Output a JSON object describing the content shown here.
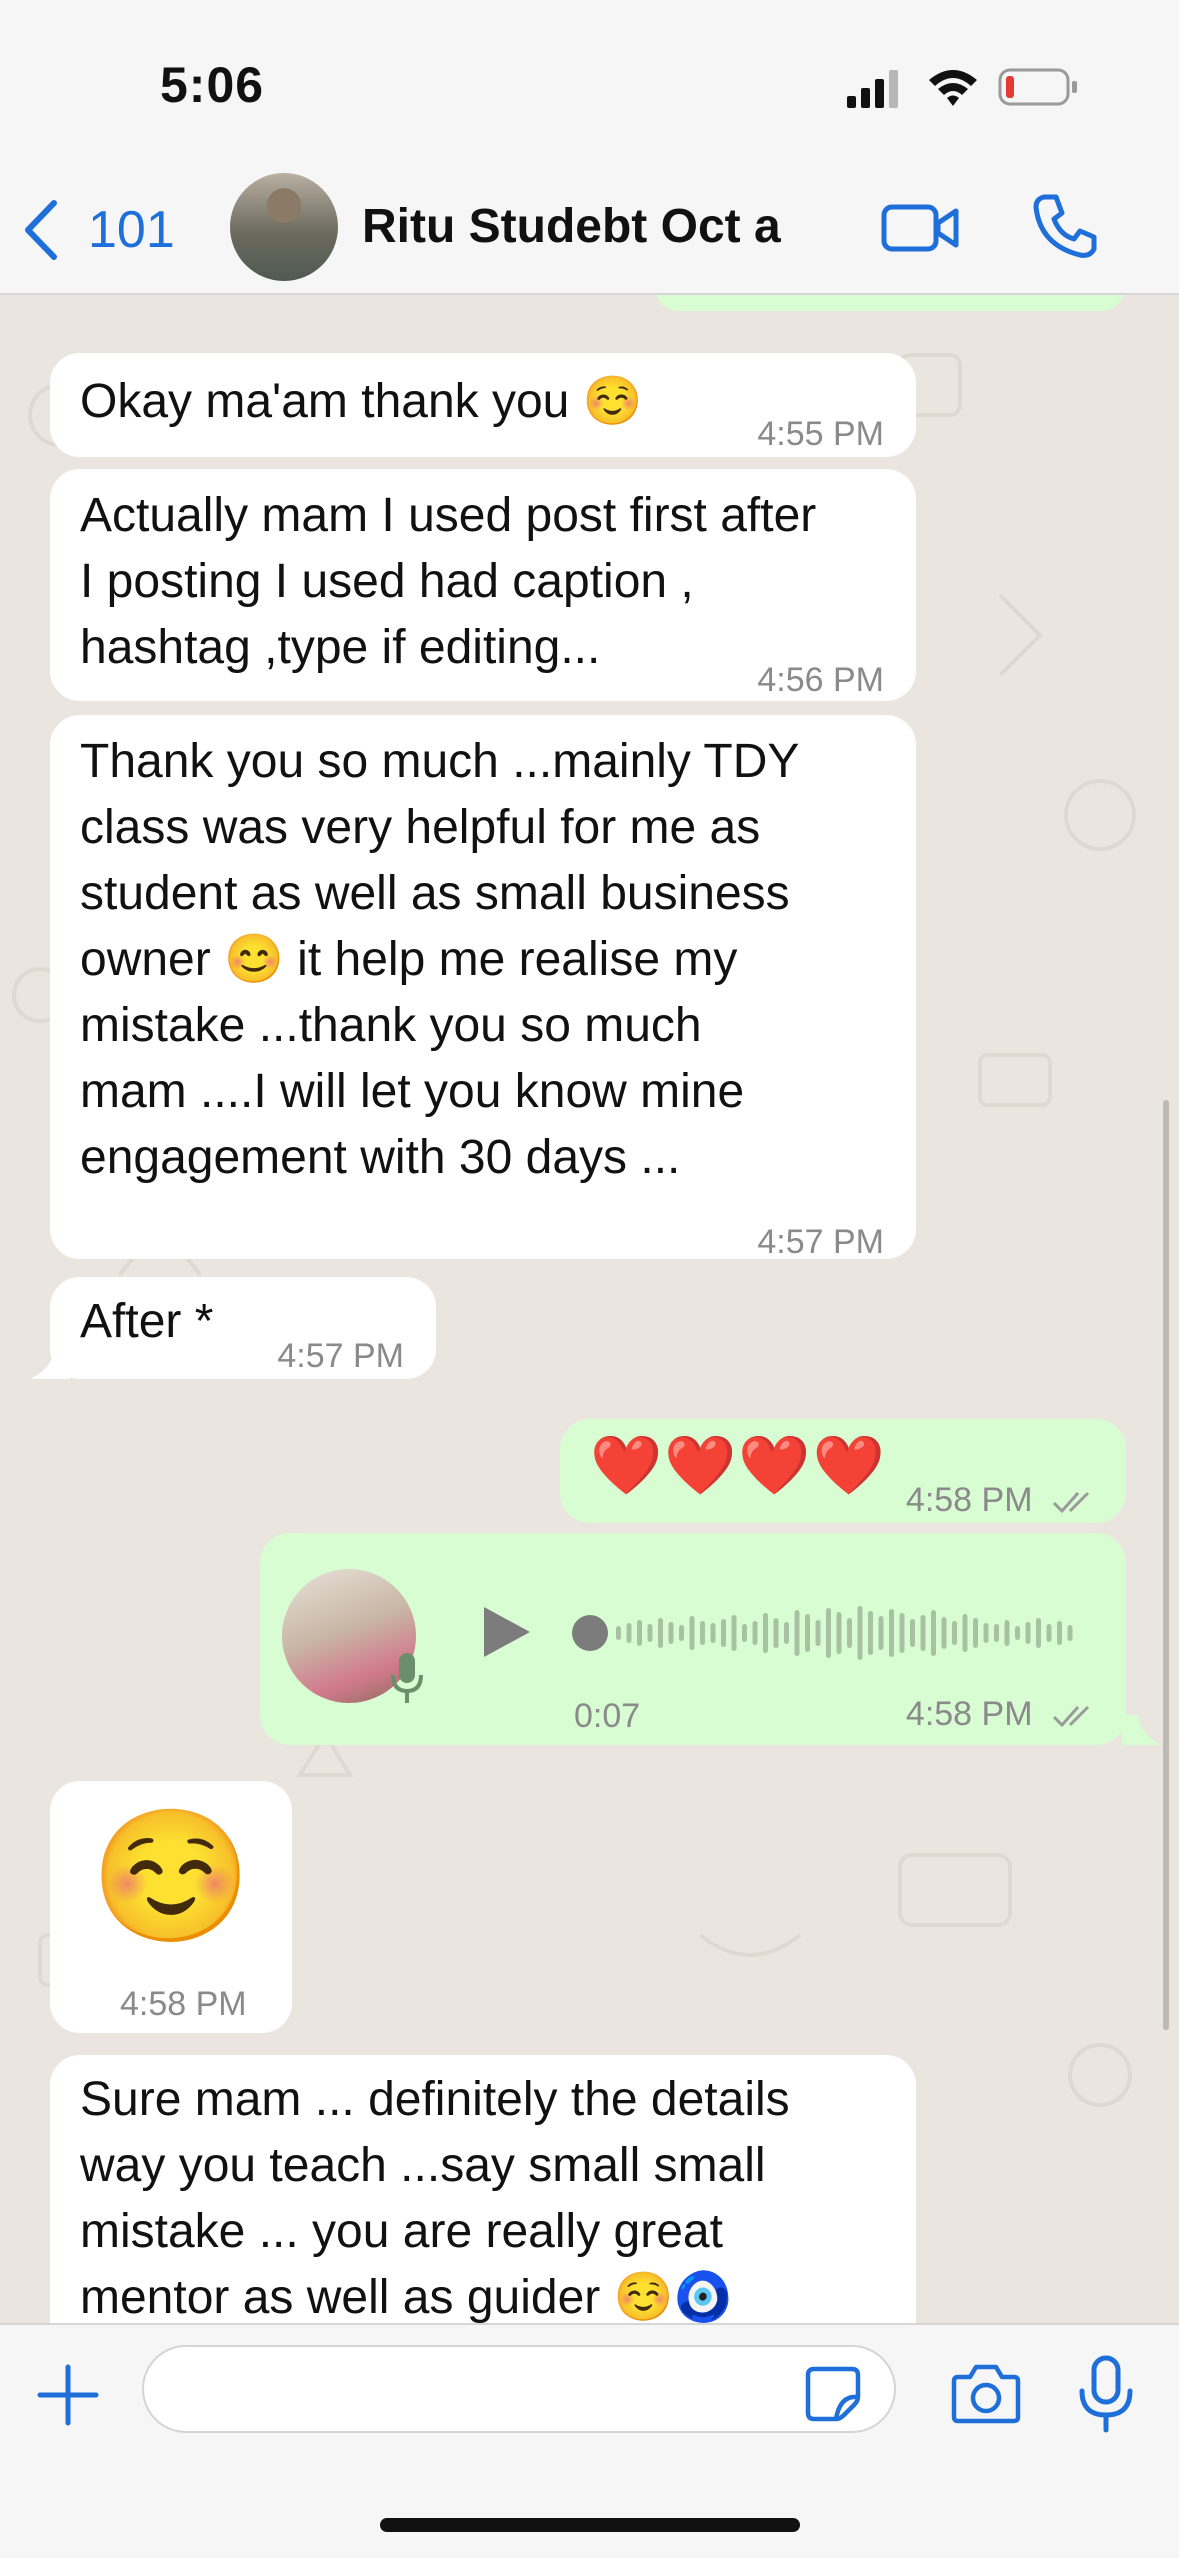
{
  "status_bar": {
    "time": "5:06",
    "icons": [
      "signal-icon",
      "wifi-icon",
      "battery-low-icon"
    ]
  },
  "header": {
    "back_count": "101",
    "contact_name": "Ritu Studebt Oct a",
    "icons": [
      "chevron-left-icon",
      "video-camera-icon",
      "phone-icon"
    ]
  },
  "messages": [
    {
      "dir": "in",
      "text": "Okay ma'am thank you ☺️",
      "time": "4:55 PM"
    },
    {
      "dir": "in",
      "text": "Actually mam I used post first after\nI posting I used had caption ,\nhashtag ,type if editing...",
      "time": "4:56 PM"
    },
    {
      "dir": "in",
      "text": "Thank you so much ...mainly TDY\nclass was very helpful for me as\nstudent as well as small business\nowner 😊 it help me realise my\nmistake ...thank you so much\nmam ....I will let you know mine\nengagement with 30 days ...",
      "time": "4:57 PM"
    },
    {
      "dir": "in",
      "text": "After *",
      "time": "4:57 PM"
    },
    {
      "dir": "out",
      "text": "❤️❤️❤️❤️",
      "time": "4:58 PM"
    },
    {
      "dir": "out",
      "type": "voice",
      "duration": "0:07",
      "time": "4:58 PM"
    },
    {
      "dir": "in",
      "type": "emoji",
      "text": "☺️",
      "time": "4:58 PM"
    },
    {
      "dir": "in",
      "text": "Sure mam ... definitely the details\nway you teach ...say small small\nmistake ... you are really great\nmentor as well as guider ☺️🧿",
      "time": ""
    }
  ],
  "composer": {
    "placeholder": ""
  },
  "colors": {
    "accent": "#1e6fd9",
    "outgoing_bubble": "#d9fdd3",
    "incoming_bubble": "#ffffff",
    "chat_bg": "#eae6df",
    "battery_low": "#e53935"
  }
}
